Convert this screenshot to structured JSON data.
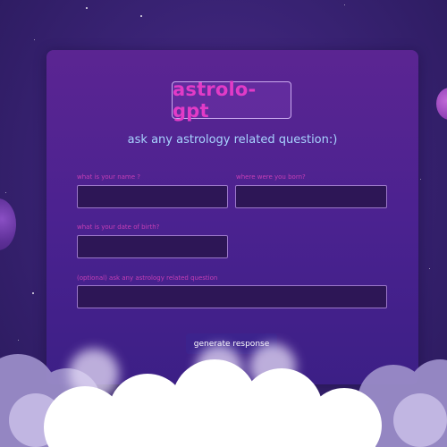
{
  "brand": {
    "title": "astrolo-gpt"
  },
  "subtitle": "ask any astrology related question:)",
  "form": {
    "name": {
      "label": "what is your name ?",
      "value": "",
      "placeholder": ""
    },
    "birthplace": {
      "label": "where were you born?",
      "value": "",
      "placeholder": ""
    },
    "dob": {
      "label": "what is your date of birth?",
      "value": "",
      "placeholder": ""
    },
    "question": {
      "label": "(optional) ask any astrology related question",
      "value": "",
      "placeholder": ""
    },
    "submit_label": "generate response"
  },
  "colors": {
    "background": "#3a2375",
    "card": "#4b2290",
    "brand_text": "#e23bc7",
    "subtitle_text": "#a8d4ff",
    "label_text": "#c73fb6",
    "input_bg": "#2d1656",
    "button_bg": "#3c238d"
  },
  "decor": {
    "left_planet": "planet",
    "right_planet": "planet",
    "bottom": "clouds",
    "sky": "stars"
  }
}
